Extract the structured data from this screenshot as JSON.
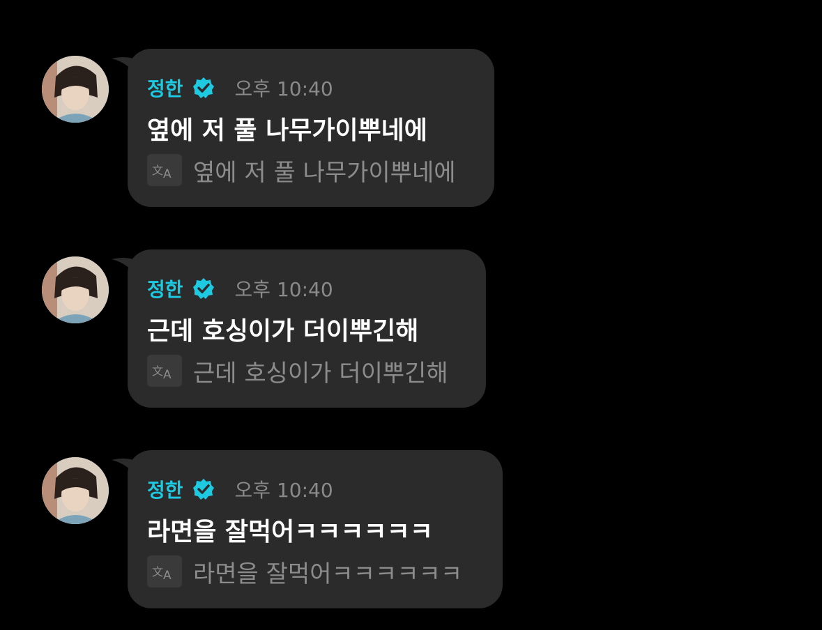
{
  "messages": [
    {
      "sender": "정한",
      "time": "오후 10:40",
      "text": "옆에 저 풀 나무가이뿌네에",
      "translation": "옆에 저 풀 나무가이뿌네에",
      "icons": {
        "verified": "verified-badge-icon",
        "translate": "translate-icon",
        "avatar": "avatar"
      }
    },
    {
      "sender": "정한",
      "time": "오후 10:40",
      "text": "근데 호싱이가 더이뿌긴해",
      "translation": "근데 호싱이가 더이뿌긴해",
      "icons": {
        "verified": "verified-badge-icon",
        "translate": "translate-icon",
        "avatar": "avatar"
      }
    },
    {
      "sender": "정한",
      "time": "오후 10:40",
      "text": "라면을 잘먹어ㅋㅋㅋㅋㅋㅋ",
      "translation": "라면을 잘먹어ㅋㅋㅋㅋㅋㅋ",
      "icons": {
        "verified": "verified-badge-icon",
        "translate": "translate-icon",
        "avatar": "avatar"
      }
    }
  ],
  "colors": {
    "background": "#000000",
    "bubble": "#2b2b2b",
    "name": "#1ec9e2",
    "time": "#8a8a8a",
    "message_text": "#ffffff",
    "translation_text": "#8c8c8c"
  }
}
